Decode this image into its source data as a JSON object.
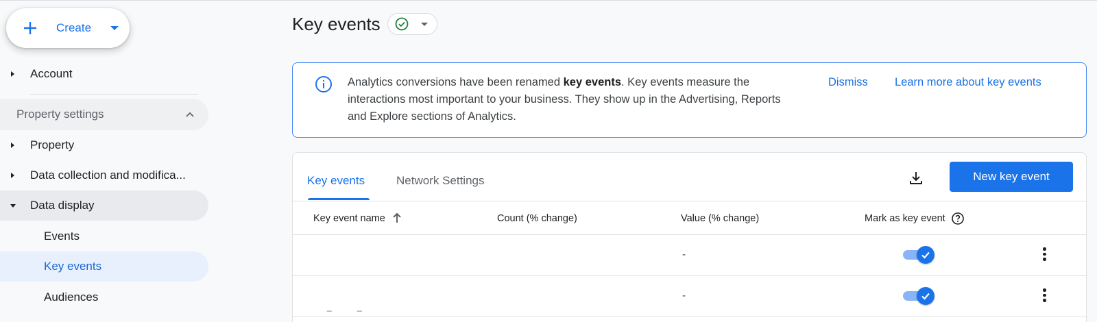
{
  "create": {
    "label": "Create"
  },
  "sidebar": {
    "account": "Account",
    "section": "Property settings",
    "items": [
      {
        "label": "Property"
      },
      {
        "label": "Data collection and modifica..."
      },
      {
        "label": "Data display"
      },
      {
        "label": "Events"
      },
      {
        "label": "Key events"
      },
      {
        "label": "Audiences"
      }
    ]
  },
  "page": {
    "title": "Key events"
  },
  "banner": {
    "text_before": "Analytics conversions have been renamed ",
    "text_bold": "key events",
    "text_after": ". Key events measure the interactions most important to your business. They show up in the Advertising, Reports and Explore sections of Analytics.",
    "dismiss": "Dismiss",
    "learn_more": "Learn more about key events"
  },
  "tabs": [
    {
      "label": "Key events",
      "active": true
    },
    {
      "label": "Network Settings",
      "active": false
    }
  ],
  "toolbar": {
    "new_button": "New key event",
    "download_icon": "download-icon"
  },
  "table": {
    "headers": [
      "Key event name",
      "Count (% change)",
      "Value (% change)",
      "Mark as key event"
    ],
    "rows": [
      {
        "name": "",
        "count": "",
        "value": "-",
        "marked": true
      },
      {
        "name": "_ _",
        "count": "",
        "value": "-",
        "marked": true
      }
    ]
  },
  "colors": {
    "accent": "#1a73e8",
    "success": "#188038"
  }
}
